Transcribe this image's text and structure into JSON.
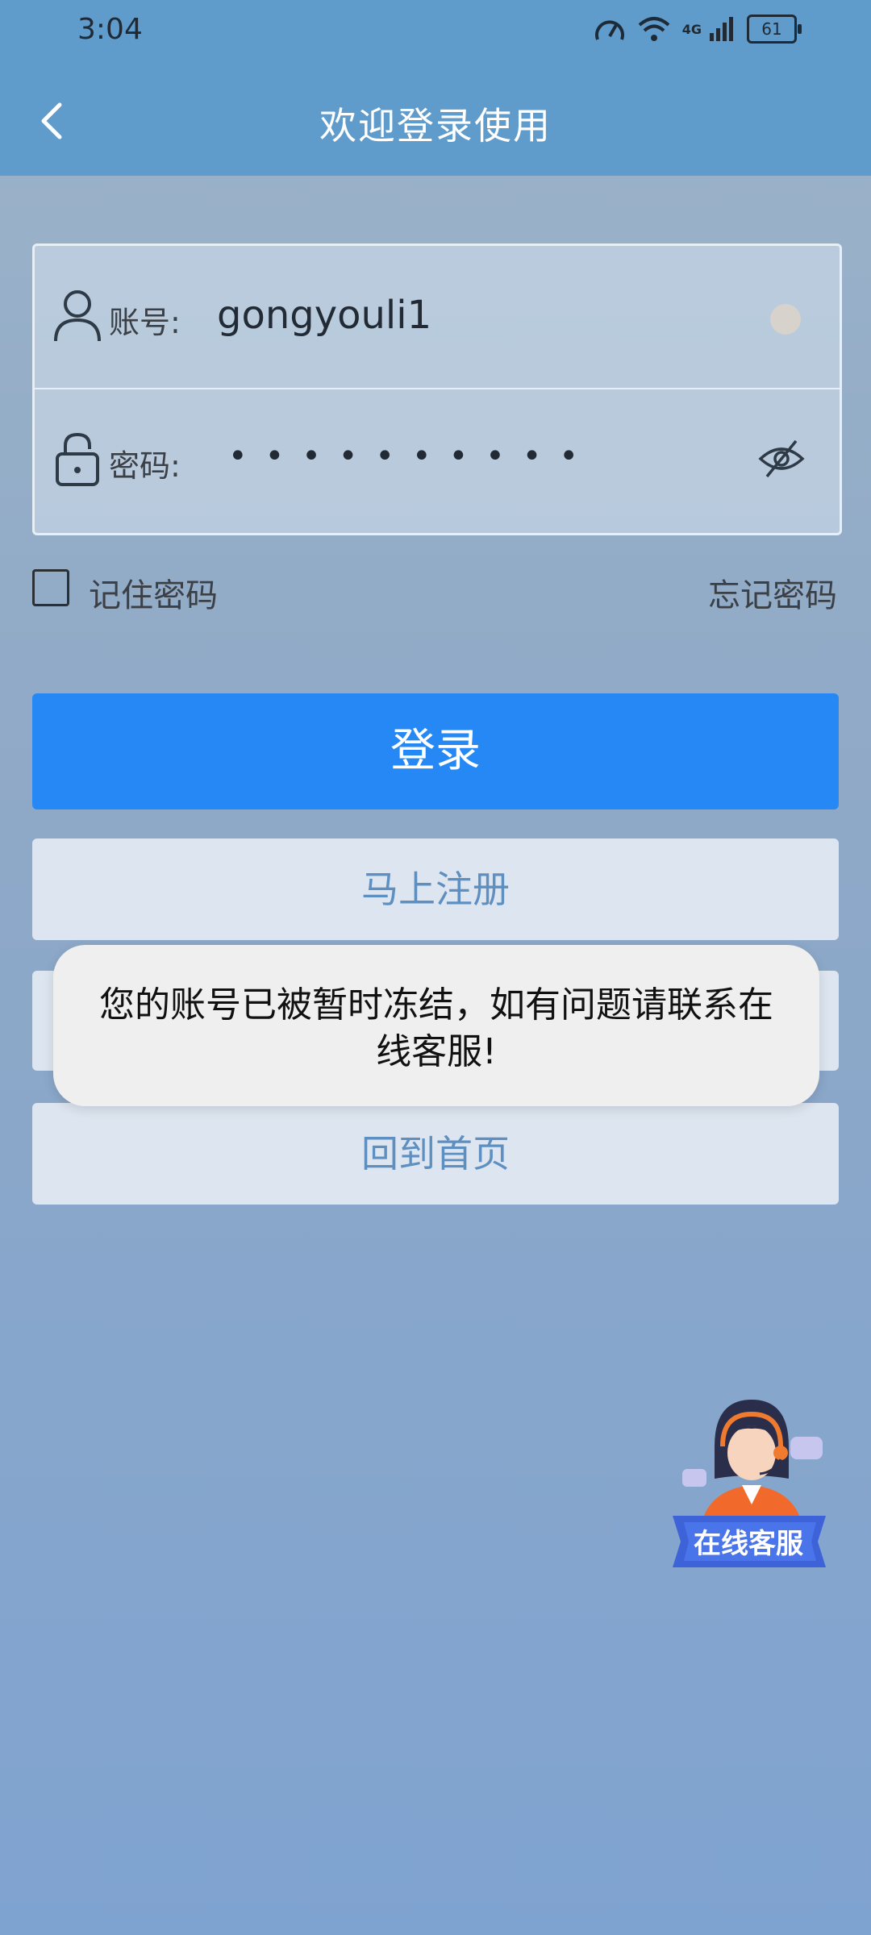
{
  "status_bar": {
    "time": "3:04",
    "battery": "61",
    "network": "4G"
  },
  "header": {
    "title": "欢迎登录使用"
  },
  "login_form": {
    "account_label": "账号:",
    "account_value": "gongyouli1",
    "password_label": "密码:",
    "password_dots": "••••••••••"
  },
  "options": {
    "remember_label": "记住密码",
    "forgot_label": "忘记密码"
  },
  "buttons": {
    "login": "登录",
    "register": "马上注册",
    "home": "回到首页"
  },
  "toast": {
    "message": "您的账号已被暂时冻结，如有问题请联系在线客服!"
  },
  "service_fab": {
    "label": "在线客服"
  },
  "colors": {
    "primary": "#2688f5",
    "header": "#5f9ccb",
    "secondary_text": "#5d8fc0"
  }
}
